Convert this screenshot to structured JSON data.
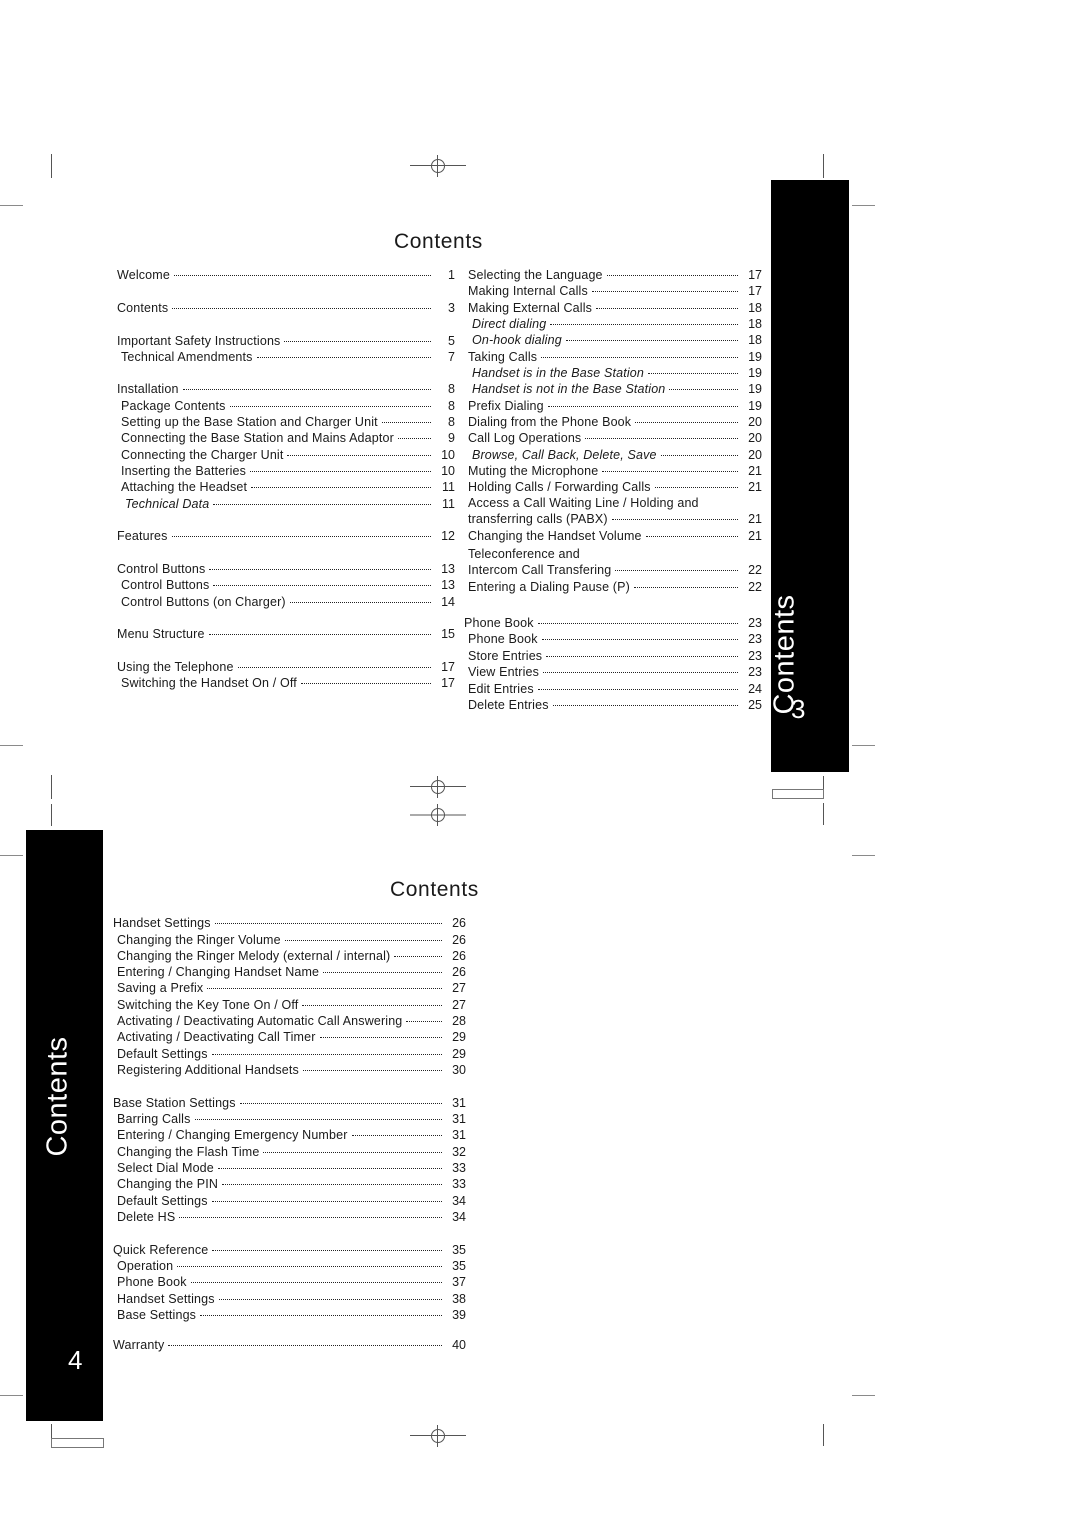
{
  "page_top": {
    "title": "Contents",
    "tab_label": "Contents",
    "page_number": "3",
    "left_column": [
      {
        "label": "Welcome",
        "page": "1",
        "indent": 0
      },
      {
        "label": "Contents",
        "page": "3",
        "indent": 0
      },
      {
        "label": "Important Safety Instructions",
        "page": "5",
        "indent": 0
      },
      {
        "label": "Technical Amendments",
        "page": "7",
        "indent": 1
      },
      {
        "label": "Installation",
        "page": "8",
        "indent": 0
      },
      {
        "label": "Package Contents",
        "page": "8",
        "indent": 1
      },
      {
        "label": "Setting up the Base Station and Charger Unit",
        "page": "8",
        "indent": 1
      },
      {
        "label": "Connecting the Base Station and Mains Adaptor",
        "page": "9",
        "indent": 1
      },
      {
        "label": "Connecting the Charger Unit",
        "page": "10",
        "indent": 1
      },
      {
        "label": "Inserting the Batteries",
        "page": "10",
        "indent": 1
      },
      {
        "label": "Attaching the Headset",
        "page": "11",
        "indent": 1
      },
      {
        "label": "Technical Data",
        "page": "11",
        "indent": 2,
        "italic": true
      },
      {
        "label": "Features",
        "page": "12",
        "indent": 0
      },
      {
        "label": "Control Buttons",
        "page": "13",
        "indent": 0
      },
      {
        "label": "Control Buttons",
        "page": "13",
        "indent": 1
      },
      {
        "label": "Control Buttons (on Charger)",
        "page": "14",
        "indent": 1
      },
      {
        "label": "Menu Structure",
        "page": "15",
        "indent": 0
      },
      {
        "label": "Using the Telephone",
        "page": "17",
        "indent": 0
      },
      {
        "label": "Switching the Handset On / Off",
        "page": "17",
        "indent": 1
      }
    ],
    "right_column": [
      {
        "label": "Selecting the Language",
        "page": "17"
      },
      {
        "label": "Making Internal Calls",
        "page": "17"
      },
      {
        "label": "Making  External Calls",
        "page": "18"
      },
      {
        "label": "Direct dialing",
        "page": "18",
        "italic": true
      },
      {
        "label": "On-hook dialing",
        "page": "18",
        "italic": true
      },
      {
        "label": "Taking Calls",
        "page": "19"
      },
      {
        "label": "Handset is in the Base Station",
        "page": "19",
        "italic": true
      },
      {
        "label": "Handset is not in the Base Station",
        "page": "19",
        "italic": true
      },
      {
        "label": "Prefix Dialing",
        "page": "19"
      },
      {
        "label": "Dialing from the Phone Book",
        "page": "20"
      },
      {
        "label": "Call Log Operations",
        "page": "20"
      },
      {
        "label": "Browse, Call Back, Delete, Save",
        "page": "20",
        "italic": true
      },
      {
        "label": "Muting the Microphone",
        "page": "21"
      },
      {
        "label": "Holding Calls / Forwarding Calls",
        "page": "21"
      },
      {
        "label": "Access a Call Waiting Line / Holding and",
        "page": ""
      },
      {
        "label": "transferring calls (PABX)",
        "page": "21"
      },
      {
        "label": "Changing the Handset Volume",
        "page": "21"
      },
      {
        "label": "Teleconference and",
        "page": ""
      },
      {
        "label": "Intercom Call Transfering",
        "page": "22"
      },
      {
        "label": "Entering a Dialing Pause (P)",
        "page": "22"
      },
      {
        "label": "Phone Book",
        "page": "23"
      },
      {
        "label": "Phone Book",
        "page": "23"
      },
      {
        "label": "Store Entries",
        "page": "23"
      },
      {
        "label": "View Entries",
        "page": "23"
      },
      {
        "label": "Edit Entries",
        "page": "24"
      },
      {
        "label": "Delete Entries",
        "page": "25"
      }
    ]
  },
  "page_bottom": {
    "title": "Contents",
    "tab_label": "Contents",
    "page_number": "4",
    "entries": [
      {
        "label": "Handset Settings",
        "page": "26",
        "indent": 0
      },
      {
        "label": "Changing the Ringer Volume",
        "page": "26",
        "indent": 1
      },
      {
        "label": "Changing the Ringer Melody (external / internal)",
        "page": "26",
        "indent": 1
      },
      {
        "label": "Entering / Changing Handset Name",
        "page": "26",
        "indent": 1
      },
      {
        "label": "Saving a Prefix",
        "page": "27",
        "indent": 1
      },
      {
        "label": "Switching the Key Tone On / Off",
        "page": "27",
        "indent": 1
      },
      {
        "label": "Activating / Deactivating Automatic Call Answering",
        "page": "28",
        "indent": 1
      },
      {
        "label": "Activating / Deactivating Call Timer",
        "page": "29",
        "indent": 1
      },
      {
        "label": "Default Settings",
        "page": "29",
        "indent": 1
      },
      {
        "label": "Registering Additional Handsets",
        "page": "30",
        "indent": 1
      },
      {
        "label": "Base Station Settings",
        "page": "31",
        "indent": 0
      },
      {
        "label": "Barring Calls",
        "page": "31",
        "indent": 1
      },
      {
        "label": "Entering / Changing Emergency Number",
        "page": "31",
        "indent": 1
      },
      {
        "label": "Changing the Flash Time",
        "page": "32",
        "indent": 1
      },
      {
        "label": "Select Dial Mode",
        "page": "33",
        "indent": 1
      },
      {
        "label": "Changing the PIN",
        "page": "33",
        "indent": 1
      },
      {
        "label": "Default Settings",
        "page": "34",
        "indent": 1
      },
      {
        "label": "Delete HS",
        "page": "34",
        "indent": 1
      },
      {
        "label": "Quick Reference",
        "page": "35",
        "indent": 0
      },
      {
        "label": "Operation",
        "page": "35",
        "indent": 1
      },
      {
        "label": "Phone Book",
        "page": "37",
        "indent": 1
      },
      {
        "label": "Handset Settings",
        "page": "38",
        "indent": 1
      },
      {
        "label": "Base Settings",
        "page": "39",
        "indent": 1
      },
      {
        "label": "Warranty",
        "page": "40",
        "indent": 0
      }
    ]
  }
}
